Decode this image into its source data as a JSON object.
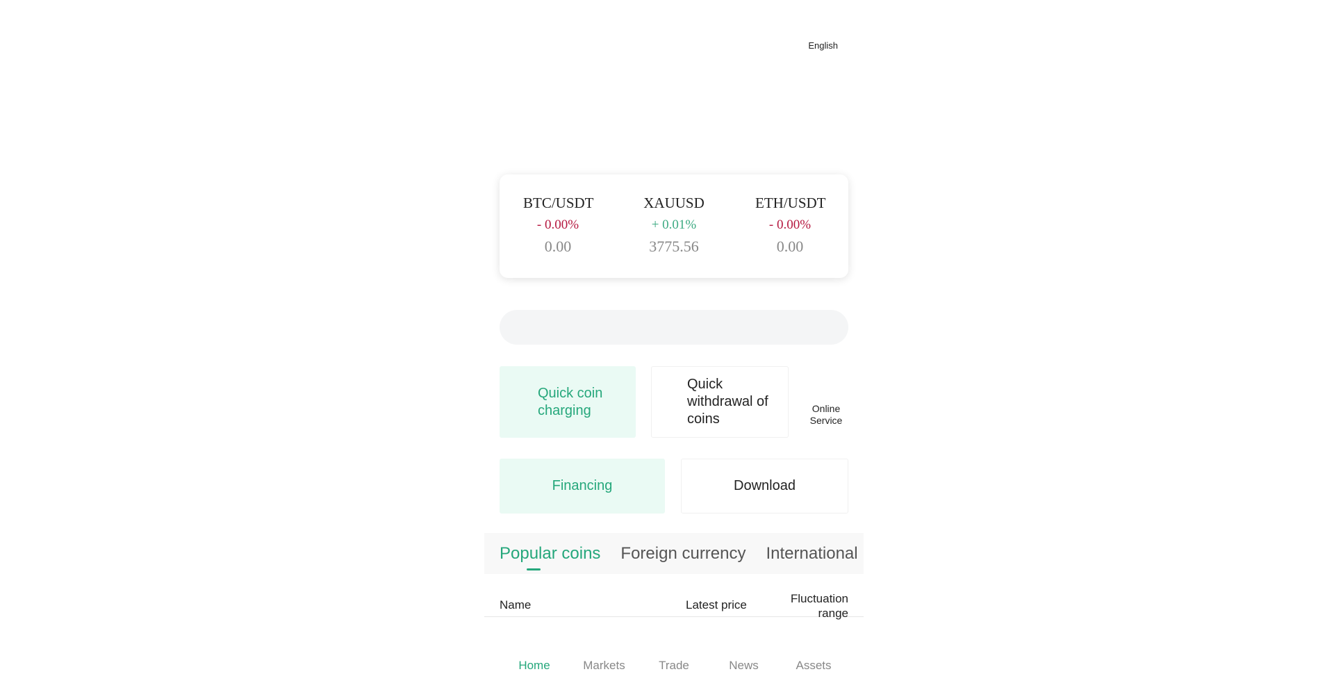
{
  "header": {
    "language": "English"
  },
  "tickers": [
    {
      "pair": "BTC/USDT",
      "change": "- 0.00%",
      "direction": "down",
      "price": "0.00"
    },
    {
      "pair": "XAUUSD",
      "change": "+ 0.01%",
      "direction": "up",
      "price": "3775.56"
    },
    {
      "pair": "ETH/USDT",
      "change": "- 0.00%",
      "direction": "down",
      "price": "0.00"
    }
  ],
  "quick_actions": {
    "charge": "Quick coin charging",
    "withdraw": "Quick withdrawal of coins",
    "service": "Online Service",
    "financing": "Financing",
    "download": "Download"
  },
  "tabs": [
    {
      "label": "Popular coins",
      "active": true
    },
    {
      "label": "Foreign currency",
      "active": false
    },
    {
      "label": "International",
      "active": false
    }
  ],
  "table_header": {
    "name": "Name",
    "price": "Latest price",
    "fluctuation": "Fluctuation range"
  },
  "bottom_nav": [
    {
      "label": "Home",
      "active": true
    },
    {
      "label": "Markets",
      "active": false
    },
    {
      "label": "Trade",
      "active": false
    },
    {
      "label": "News",
      "active": false
    },
    {
      "label": "Assets",
      "active": false
    }
  ],
  "colors": {
    "accent": "#25a77b",
    "down": "#b5173f",
    "up": "#3daa82",
    "accent_bg": "#eafaf4"
  }
}
